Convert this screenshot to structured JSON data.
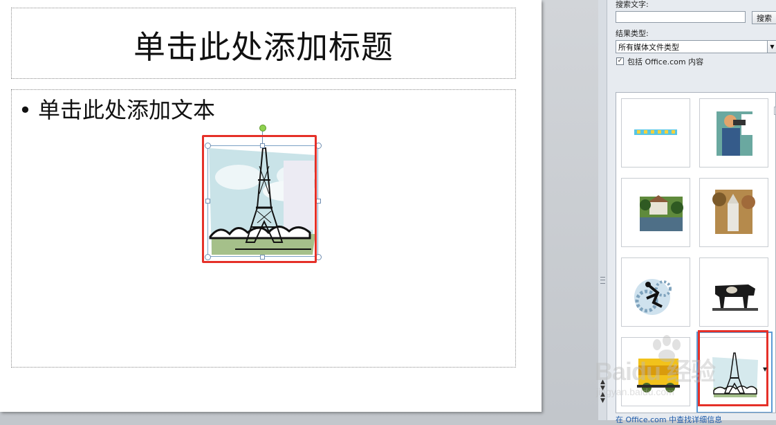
{
  "slide": {
    "title_placeholder": "单击此处添加标题",
    "bullet_char": "•",
    "content_placeholder": "单击此处添加文本"
  },
  "task_pane": {
    "search_label": "搜索文字:",
    "search_value": "",
    "search_button": "搜索",
    "result_type_label": "结果类型:",
    "result_type_value": "所有媒体文件类型",
    "include_office_label": "包括 Office.com 内容",
    "include_office_checked": true,
    "bottom_link": "在 Office.com 中查找详细信息"
  },
  "thumbnails": [
    {
      "icon": "border-strip-icon"
    },
    {
      "icon": "eye-exam-icon"
    },
    {
      "icon": "house-landscape-icon"
    },
    {
      "icon": "church-trees-icon"
    },
    {
      "icon": "runner-gears-icon"
    },
    {
      "icon": "cow-icon"
    },
    {
      "icon": "yellow-truck-icon"
    },
    {
      "icon": "eiffel-tower-icon",
      "selected": true
    }
  ],
  "watermark": {
    "brand": "Baidu 经验",
    "sub": "jingyan.baidu.com"
  },
  "colors": {
    "highlight_red": "#e53028",
    "selection_blue": "#5b9bd5",
    "rotate_green": "#8fd14f"
  }
}
